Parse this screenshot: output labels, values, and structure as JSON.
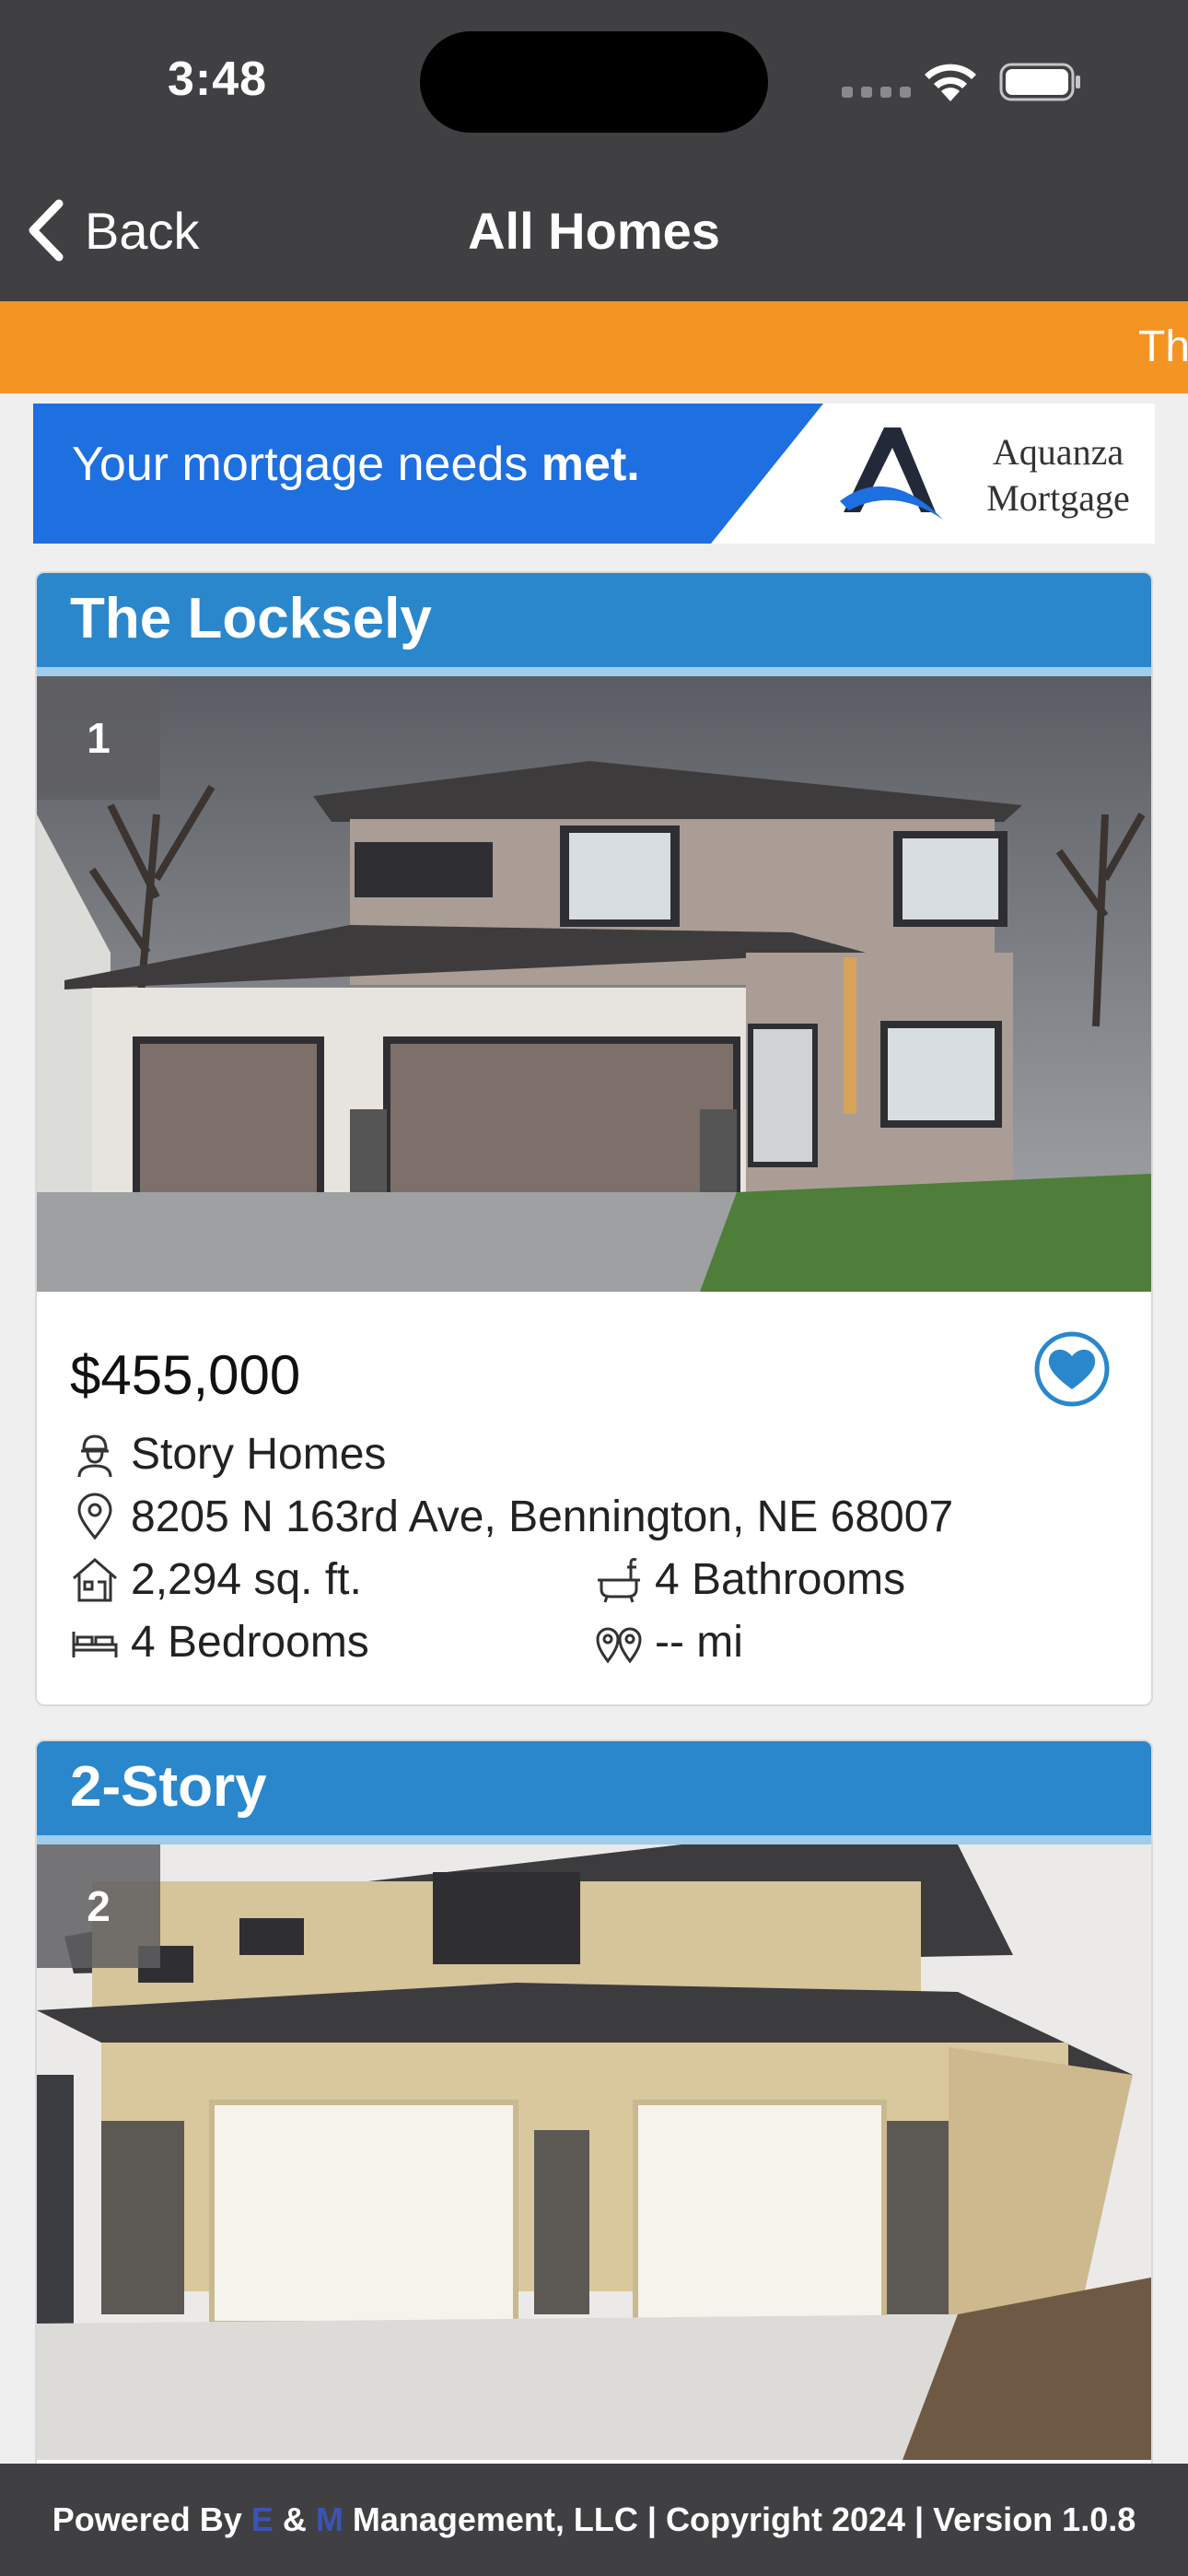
{
  "status": {
    "time": "3:48"
  },
  "nav": {
    "back_label": "Back",
    "title": "All Homes"
  },
  "ticker": {
    "text": "Th"
  },
  "ad": {
    "text_prefix": "Your mortgage needs ",
    "text_bold": "met.",
    "brand_line1": "Aquanza",
    "brand_line2": "Mortgage"
  },
  "listings": [
    {
      "title": "The Locksely",
      "index": "1",
      "price": "$455,000",
      "builder": "Story Homes",
      "address": "8205 N 163rd Ave, Bennington, NE 68007",
      "sqft": "2,294 sq. ft.",
      "bathrooms": "4 Bathrooms",
      "bedrooms": "4 Bedrooms",
      "distance": "-- mi"
    },
    {
      "title": "2-Story",
      "index": "2"
    }
  ],
  "footer": {
    "prefix": "Powered By ",
    "e": "E",
    "amp": " & ",
    "m": "M",
    "suffix": " Management, LLC | Copyright 2024 | Version 1.0.8"
  },
  "colors": {
    "nav_bg": "#404043",
    "ticker_bg": "#f49523",
    "header_bg": "#2a87cc",
    "accent": "#2a87cc"
  }
}
